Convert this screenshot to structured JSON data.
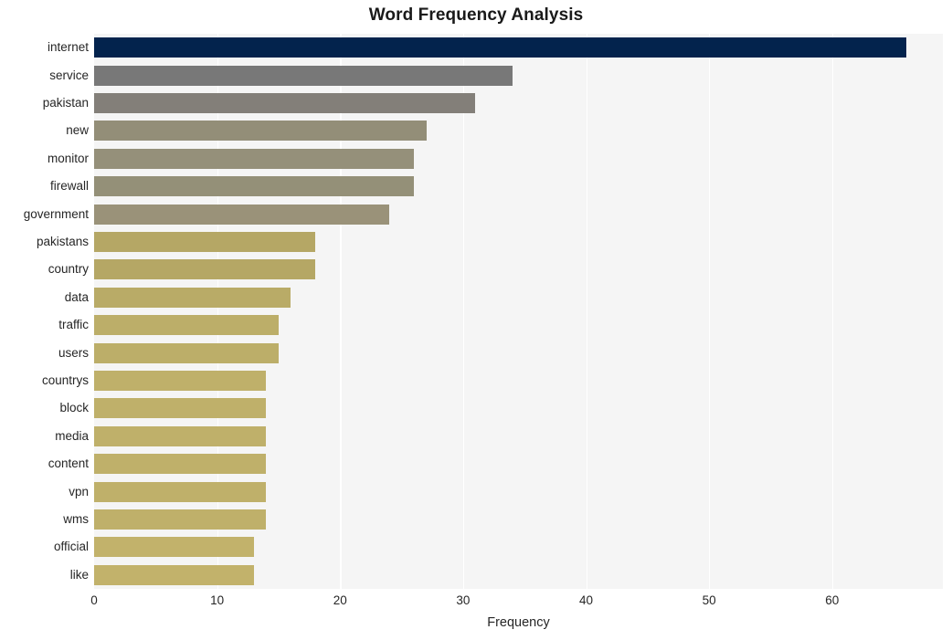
{
  "chart_data": {
    "type": "bar",
    "orientation": "horizontal",
    "title": "Word Frequency Analysis",
    "xlabel": "Frequency",
    "ylabel": "",
    "xlim": [
      0,
      69
    ],
    "xticks": [
      0,
      10,
      20,
      30,
      40,
      50,
      60
    ],
    "xticklabels": [
      "0",
      "10",
      "20",
      "30",
      "40",
      "50",
      "60"
    ],
    "grid": "vertical-only",
    "legend": "none",
    "categories": [
      "internet",
      "service",
      "pakistan",
      "new",
      "monitor",
      "firewall",
      "government",
      "pakistans",
      "country",
      "data",
      "traffic",
      "users",
      "countrys",
      "block",
      "media",
      "content",
      "vpn",
      "wms",
      "official",
      "like"
    ],
    "values": [
      66,
      34,
      31,
      27,
      26,
      26,
      24,
      18,
      18,
      16,
      15,
      15,
      14,
      14,
      14,
      14,
      14,
      14,
      13,
      13
    ],
    "bar_colors": [
      "#03234d",
      "#787878",
      "#837f79",
      "#938e78",
      "#95907a",
      "#949078",
      "#9a9279",
      "#b5a765",
      "#b5a765",
      "#b9ab67",
      "#bcae69",
      "#bcae69",
      "#bfb06a",
      "#bfb06a",
      "#bfb06a",
      "#bfb06a",
      "#bfb06a",
      "#bfb06a",
      "#c2b26b",
      "#c2b26b"
    ],
    "plot_background": "#f5f5f5",
    "gridline_color": "#ffffff",
    "figure_background": "#ffffff"
  }
}
